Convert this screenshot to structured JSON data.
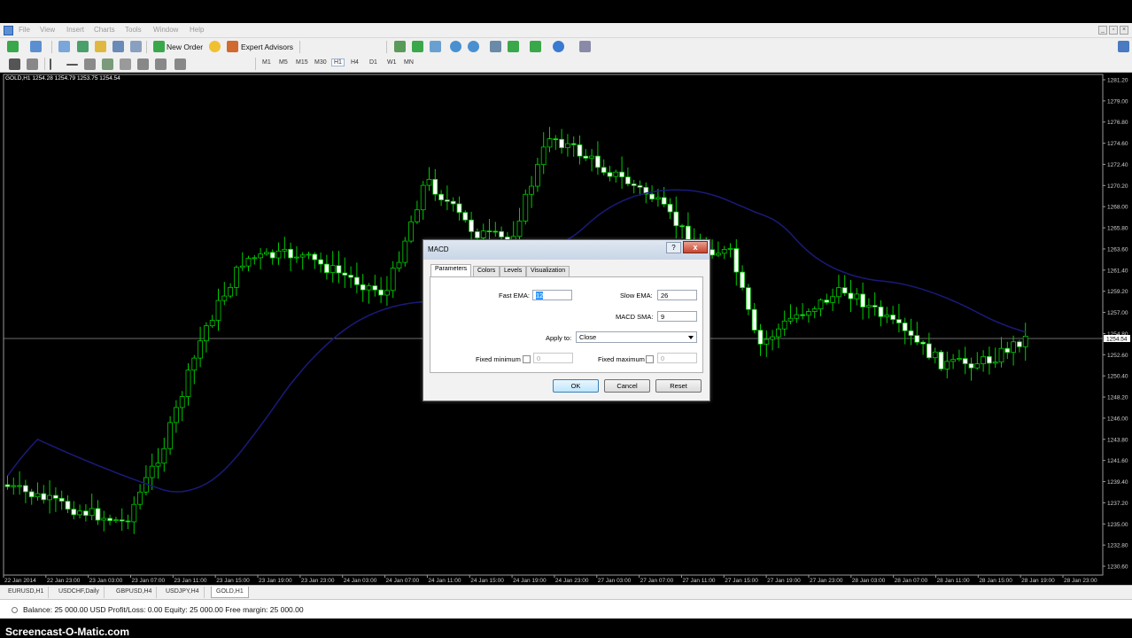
{
  "menu": [
    "File",
    "View",
    "Insert",
    "Charts",
    "Tools",
    "Window",
    "Help"
  ],
  "toolbar": {
    "new_order": "New Order",
    "expert_advisors": "Expert Advisors"
  },
  "timeframes": [
    "M1",
    "M5",
    "M15",
    "M30",
    "H1",
    "H4",
    "D1",
    "W1",
    "MN"
  ],
  "active_timeframe": "H1",
  "chart": {
    "title": "GOLD,H1  1254.28 1254.79 1253.75 1254.54",
    "current_price": "1254.54",
    "price_labels": [
      "1281.20",
      "1279.00",
      "1276.80",
      "1274.60",
      "1272.40",
      "1270.20",
      "1268.00",
      "1265.80",
      "1263.60",
      "1261.40",
      "1259.20",
      "1257.00",
      "1254.80",
      "1252.60",
      "1250.40",
      "1248.20",
      "1246.00",
      "1243.80",
      "1241.60",
      "1239.40",
      "1237.20",
      "1235.00",
      "1232.80",
      "1230.60"
    ],
    "time_labels": [
      "22 Jan 2014",
      "22 Jan 23:00",
      "23 Jan 03:00",
      "23 Jan 07:00",
      "23 Jan 11:00",
      "23 Jan 15:00",
      "23 Jan 19:00",
      "23 Jan 23:00",
      "24 Jan 03:00",
      "24 Jan 07:00",
      "24 Jan 11:00",
      "24 Jan 15:00",
      "24 Jan 19:00",
      "24 Jan 23:00",
      "27 Jan 03:00",
      "27 Jan 07:00",
      "27 Jan 11:00",
      "27 Jan 15:00",
      "27 Jan 19:00",
      "27 Jan 23:00",
      "28 Jan 03:00",
      "28 Jan 07:00",
      "28 Jan 11:00",
      "28 Jan 15:00",
      "28 Jan 19:00",
      "28 Jan 23:00"
    ],
    "colors": {
      "bg": "#000000",
      "candle": "#00cc00",
      "ma": "#1a1a7a",
      "bid_line": "#909090"
    }
  },
  "tabs": [
    "EURUSD,H1",
    "USDCHF,Daily",
    "GBPUSD,H4",
    "USDJPY,H4",
    "GOLD,H1"
  ],
  "active_tab": "GOLD,H1",
  "status": "Balance: 25 000.00 USD  Profit/Loss: 0.00  Equity: 25 000.00  Free margin: 25 000.00",
  "watermark": "Screencast-O-Matic.com",
  "dialog": {
    "title": "MACD",
    "help": "?",
    "close": "x",
    "tabs": [
      "Parameters",
      "Colors",
      "Levels",
      "Visualization"
    ],
    "fast_ema_label": "Fast EMA:",
    "fast_ema_value": "12",
    "slow_ema_label": "Slow EMA:",
    "slow_ema_value": "26",
    "macd_sma_label": "MACD SMA:",
    "macd_sma_value": "9",
    "apply_to_label": "Apply to:",
    "apply_to_value": "Close",
    "fixed_min_label": "Fixed minimum",
    "fixed_min_value": "0",
    "fixed_max_label": "Fixed maximum",
    "fixed_max_value": "0",
    "ok": "OK",
    "cancel": "Cancel",
    "reset": "Reset"
  }
}
